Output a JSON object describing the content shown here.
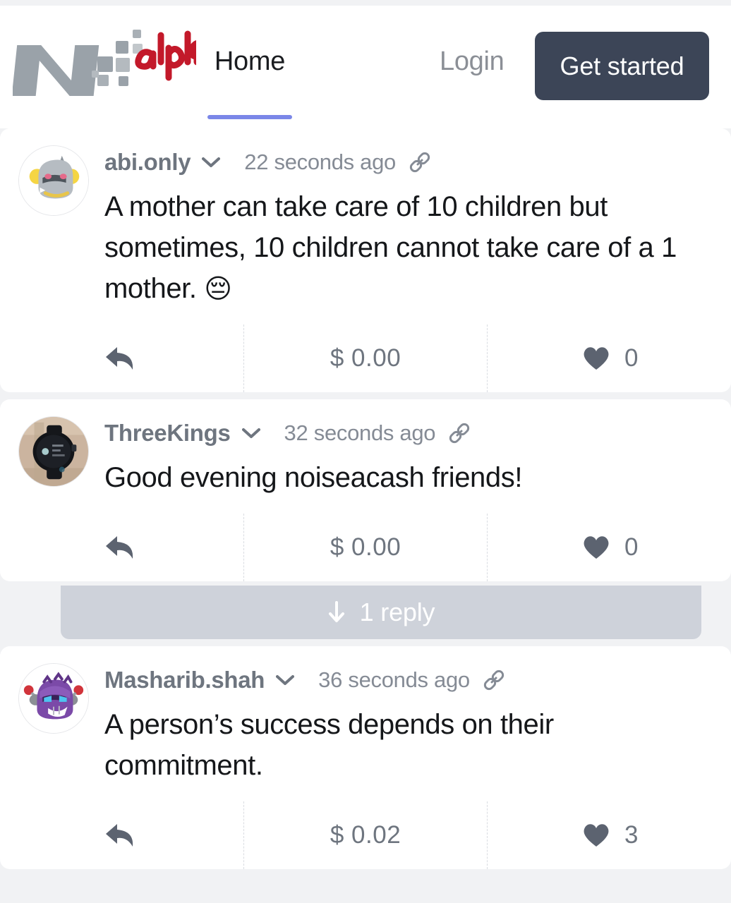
{
  "header": {
    "logo": {
      "mark_letter": "N",
      "tagline": "alpha!",
      "mark_color": "#9aa2a9",
      "tagline_color": "#c3192a"
    },
    "nav": [
      {
        "label": "Home",
        "active": true
      },
      {
        "label": "Login",
        "active": false
      }
    ],
    "cta": {
      "label": "Get started",
      "bg": "#3c4557",
      "fg": "#ffffff"
    },
    "active_underline_color": "#7b87e8"
  },
  "feed": {
    "posts": [
      {
        "avatar": "aggron-avatar",
        "username": "abi.only",
        "timestamp": "22 seconds ago",
        "text": "A mother can take care of 10 children but sometimes, 10 children cannot take care of a 1 mother. ",
        "emoji": "😔",
        "amount": "$ 0.00",
        "likes": "0",
        "reply_expander": null
      },
      {
        "avatar": "smartwatch-photo-avatar",
        "username": "ThreeKings",
        "timestamp": "32 seconds ago",
        "text": "Good evening noiseacash friends!",
        "emoji": "",
        "amount": "$ 0.00",
        "likes": "0",
        "reply_expander": "1 reply"
      },
      {
        "avatar": "probopass-avatar",
        "username": "Masharib.shah",
        "timestamp": "36 seconds ago",
        "text": "A person’s success depends on their commitment.",
        "emoji": "",
        "amount": "$ 0.02",
        "likes": "3",
        "reply_expander": null
      }
    ]
  },
  "icons": {
    "chevron_down": "chevron-down-icon",
    "link": "link-icon",
    "reply": "reply-arrow-icon",
    "heart": "heart-icon",
    "arrow_down": "arrow-down-icon"
  },
  "colors": {
    "page_bg": "#f1f2f4",
    "card_bg": "#ffffff",
    "muted_text": "#6e757f",
    "body_text": "#15171a",
    "divider": "#d9dce1",
    "reply_bar_bg": "#ced2da"
  }
}
